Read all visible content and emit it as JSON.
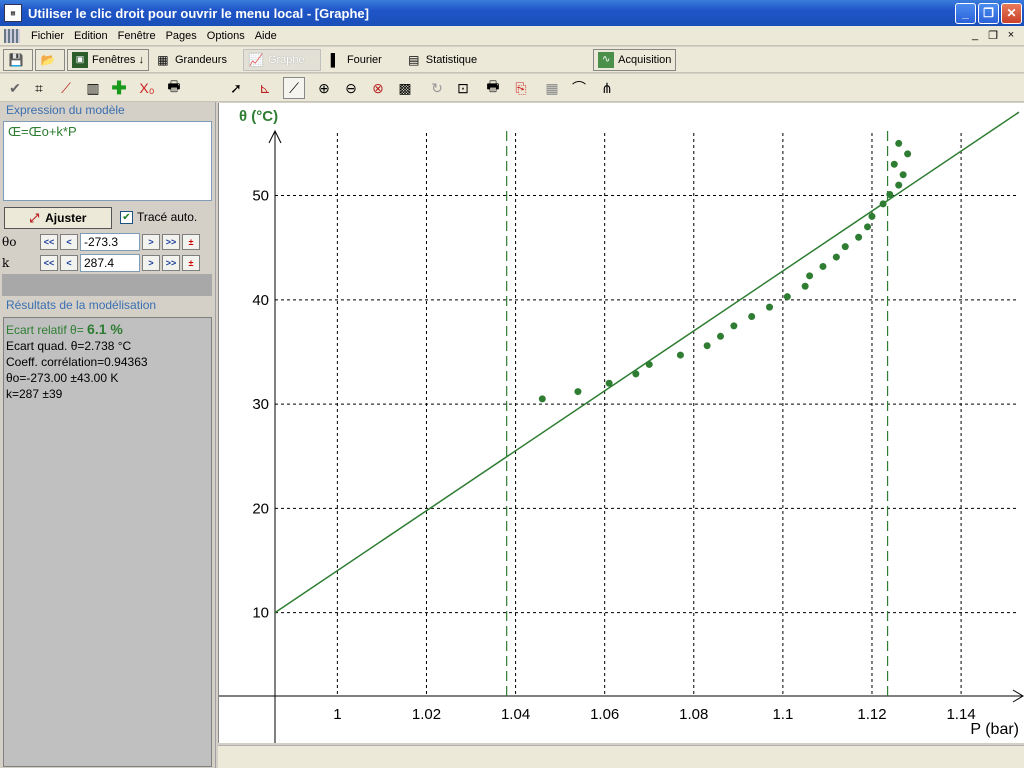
{
  "window": {
    "title": "Utiliser le clic droit pour ouvrir le menu local - [Graphe]",
    "icon": "app-icon",
    "buttons": [
      "minimize",
      "restore",
      "close"
    ]
  },
  "menu": {
    "items": [
      "Fichier",
      "Edition",
      "Fenêtre",
      "Pages",
      "Options",
      "Aide"
    ],
    "right_controls": [
      "_",
      "❐",
      "×"
    ]
  },
  "toolbar1": {
    "fenetres": "Fenêtres ↓",
    "grandeurs": "Grandeurs",
    "graphe": "Graphe",
    "fourier": "Fourier",
    "statistique": "Statistique",
    "acquisition": "Acquisition"
  },
  "left": {
    "expression_title": "Expression du modèle",
    "expression": "Œ=Œo+k*P",
    "fit_button": "Ajuster",
    "auto_trace": "Tracé auto.",
    "auto_trace_checked": true,
    "params": [
      {
        "name": "θo",
        "value": "-273.3"
      },
      {
        "name": "k",
        "value": "287.4"
      }
    ],
    "results_title": "Résultats de la modélisation",
    "results": {
      "ecart_relatif_label": "Ecart relatif θ=",
      "ecart_relatif_value": "6.1 %",
      "ecart_quad": "Ecart quad. θ=2.738 °C",
      "coeff": "Coeff. corrélation=0.94363",
      "theta0": "θo=-273.00 ±43.00 K",
      "k": "k=287 ±39"
    }
  },
  "chart_data": {
    "type": "scatter",
    "ylabel": "θ (°C)",
    "xlabel": "P (bar)",
    "x_ticks": [
      "1",
      "1.02",
      "1.04",
      "1.06",
      "1.08",
      "1.1",
      "1.12",
      "1.14"
    ],
    "y_ticks": [
      "10",
      "20",
      "30",
      "40",
      "50"
    ],
    "xlim": [
      0.986,
      1.153
    ],
    "ylim": [
      2,
      56
    ],
    "grid": true,
    "line_color": "#2e7d32",
    "point_color": "#2e7d32",
    "model_line": {
      "x": [
        0.986,
        1.153
      ],
      "y": [
        10.0,
        58.0
      ]
    },
    "cursors": [
      1.038,
      1.1235
    ],
    "points": [
      {
        "x": 1.046,
        "y": 30.5
      },
      {
        "x": 1.054,
        "y": 31.2
      },
      {
        "x": 1.061,
        "y": 32.0
      },
      {
        "x": 1.067,
        "y": 32.9
      },
      {
        "x": 1.07,
        "y": 33.8
      },
      {
        "x": 1.077,
        "y": 34.7
      },
      {
        "x": 1.083,
        "y": 35.6
      },
      {
        "x": 1.086,
        "y": 36.5
      },
      {
        "x": 1.089,
        "y": 37.5
      },
      {
        "x": 1.093,
        "y": 38.4
      },
      {
        "x": 1.097,
        "y": 39.3
      },
      {
        "x": 1.101,
        "y": 40.3
      },
      {
        "x": 1.105,
        "y": 41.3
      },
      {
        "x": 1.106,
        "y": 42.3
      },
      {
        "x": 1.109,
        "y": 43.2
      },
      {
        "x": 1.112,
        "y": 44.1
      },
      {
        "x": 1.114,
        "y": 45.1
      },
      {
        "x": 1.117,
        "y": 46.0
      },
      {
        "x": 1.119,
        "y": 47.0
      },
      {
        "x": 1.12,
        "y": 48.0
      },
      {
        "x": 1.1225,
        "y": 49.2
      },
      {
        "x": 1.124,
        "y": 50.1
      },
      {
        "x": 1.126,
        "y": 51.0
      },
      {
        "x": 1.127,
        "y": 52.0
      },
      {
        "x": 1.125,
        "y": 53.0
      },
      {
        "x": 1.128,
        "y": 54.0
      },
      {
        "x": 1.126,
        "y": 55.0
      }
    ]
  }
}
